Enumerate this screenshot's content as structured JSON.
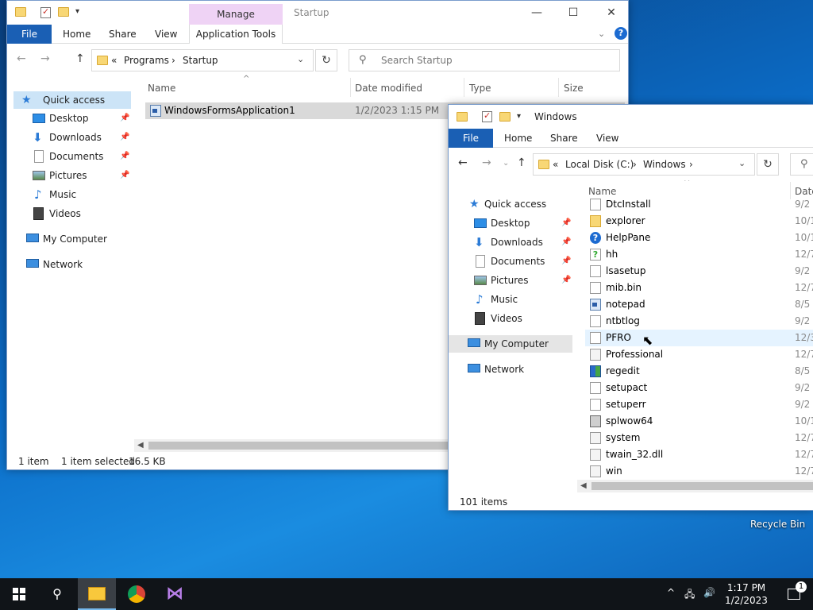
{
  "win1": {
    "manage_tab": "Manage",
    "title": "Startup",
    "ribbon": {
      "file": "File",
      "home": "Home",
      "share": "Share",
      "view": "View",
      "app_tools": "Application Tools"
    },
    "address": {
      "prefix": "«",
      "crumb1": "Programs",
      "sep": "›",
      "crumb2": "Startup"
    },
    "search_placeholder": "Search Startup",
    "nav": [
      {
        "label": "Quick access"
      },
      {
        "label": "Desktop"
      },
      {
        "label": "Downloads"
      },
      {
        "label": "Documents"
      },
      {
        "label": "Pictures"
      },
      {
        "label": "Music"
      },
      {
        "label": "Videos"
      },
      {
        "label": "My Computer"
      },
      {
        "label": "Network"
      }
    ],
    "columns": {
      "name": "Name",
      "date": "Date modified",
      "type": "Type",
      "size": "Size"
    },
    "files": [
      {
        "name": "WindowsFormsApplication1",
        "date": "1/2/2023 1:15 PM"
      }
    ],
    "status": {
      "count": "1 item",
      "selected": "1 item selected",
      "size": "16.5 KB"
    }
  },
  "win2": {
    "title": "Windows",
    "ribbon": {
      "file": "File",
      "home": "Home",
      "share": "Share",
      "view": "View"
    },
    "address": {
      "prefix": "«",
      "crumb1": "Local Disk (C:)",
      "sep": "›",
      "crumb2": "Windows",
      "sep2": "›"
    },
    "nav": [
      {
        "label": "Quick access"
      },
      {
        "label": "Desktop"
      },
      {
        "label": "Downloads"
      },
      {
        "label": "Documents"
      },
      {
        "label": "Pictures"
      },
      {
        "label": "Music"
      },
      {
        "label": "Videos"
      },
      {
        "label": "My Computer"
      },
      {
        "label": "Network"
      }
    ],
    "columns": {
      "name": "Name",
      "date": "Date"
    },
    "files": [
      {
        "name": "DtcInstall",
        "date": "9/2",
        "icon": "doc-icon"
      },
      {
        "name": "explorer",
        "date": "10/1",
        "icon": "folder-app-icon"
      },
      {
        "name": "HelpPane",
        "date": "10/1",
        "icon": "help-icon"
      },
      {
        "name": "hh",
        "date": "12/7",
        "icon": "help-file-icon"
      },
      {
        "name": "lsasetup",
        "date": "9/2",
        "icon": "doc-icon"
      },
      {
        "name": "mib.bin",
        "date": "12/7",
        "icon": "doc-icon"
      },
      {
        "name": "notepad",
        "date": "8/5",
        "icon": "app-icon"
      },
      {
        "name": "ntbtlog",
        "date": "9/2",
        "icon": "doc-icon"
      },
      {
        "name": "PFRO",
        "date": "12/3",
        "icon": "doc-icon"
      },
      {
        "name": "Professional",
        "date": "12/7",
        "icon": "config-icon"
      },
      {
        "name": "regedit",
        "date": "8/5",
        "icon": "registry-icon"
      },
      {
        "name": "setupact",
        "date": "9/2",
        "icon": "doc-icon"
      },
      {
        "name": "setuperr",
        "date": "9/2",
        "icon": "doc-icon"
      },
      {
        "name": "splwow64",
        "date": "10/1",
        "icon": "printer-icon"
      },
      {
        "name": "system",
        "date": "12/7",
        "icon": "config-icon"
      },
      {
        "name": "twain_32.dll",
        "date": "12/7",
        "icon": "dll-icon"
      },
      {
        "name": "win",
        "date": "12/7",
        "icon": "config-icon"
      }
    ],
    "status": {
      "count": "101 items"
    }
  },
  "desktop": {
    "recycle_bin": "Recycle Bin"
  },
  "taskbar": {
    "time": "1:17 PM",
    "date": "1/2/2023",
    "notif_count": "1"
  }
}
